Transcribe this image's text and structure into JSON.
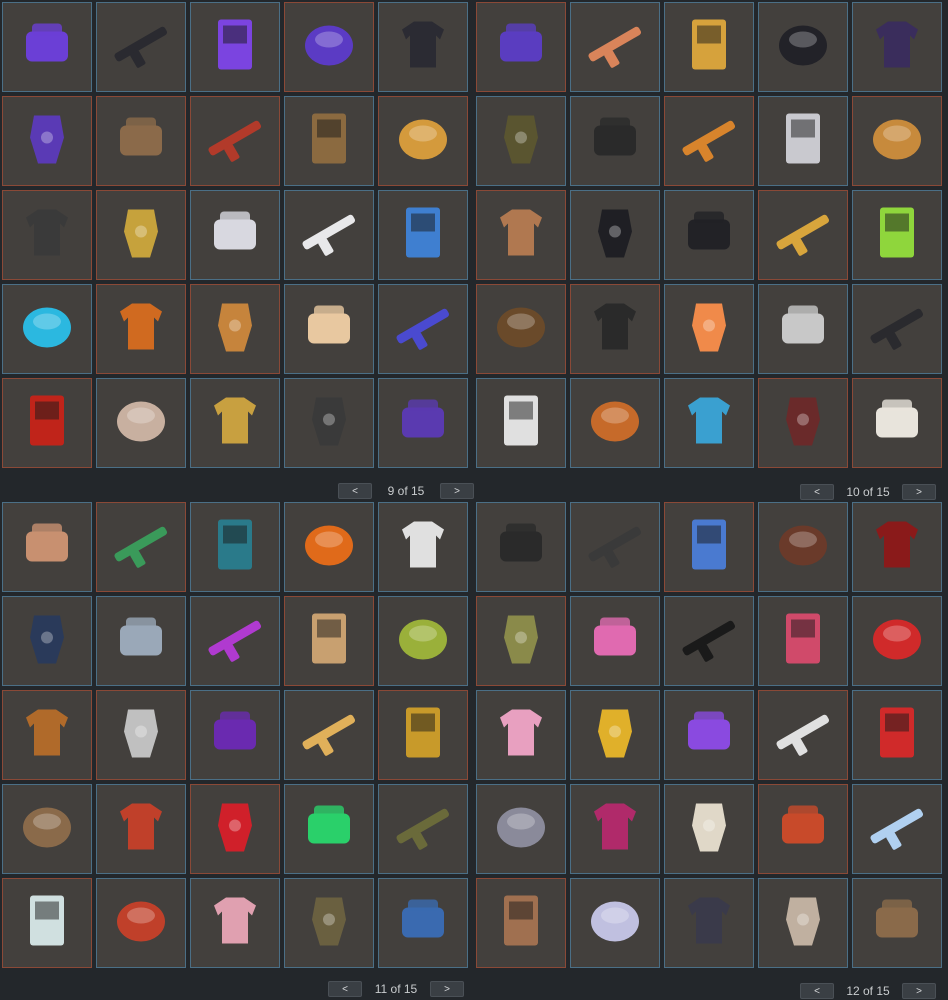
{
  "colors": {
    "background": "#23272b",
    "slot_fill": "#43403d",
    "border_blue": "#4b6f86",
    "border_red": "#8a4937"
  },
  "pagers": [
    {
      "prev_label": "<",
      "text": "9 of 15",
      "next_label": ">"
    },
    {
      "prev_label": "<",
      "text": "10 of 15",
      "next_label": ">"
    },
    {
      "prev_label": "<",
      "text": "11 of 15",
      "next_label": ">"
    },
    {
      "prev_label": "<",
      "text": "12 of 15",
      "next_label": ">"
    }
  ],
  "panels": [
    {
      "slots": [
        {
          "border": "b",
          "icon": "purple-helmet-icon",
          "color": "#6b3fd6"
        },
        {
          "border": "b",
          "icon": "backpack-icon",
          "color": "#2a2a30"
        },
        {
          "border": "b",
          "icon": "bandana-icon",
          "color": "#7b44e0"
        },
        {
          "border": "r",
          "icon": "pistol-icon",
          "color": "#5b3bc4"
        },
        {
          "border": "b",
          "icon": "vending-machine-icon",
          "color": "#2b2b33"
        },
        {
          "border": "r",
          "icon": "rifle-icon",
          "color": "#5a3dc0"
        },
        {
          "border": "b",
          "icon": "hoodie-icon",
          "color": "#d9845a"
        },
        {
          "border": "b",
          "icon": "vase-icon",
          "color": "#d6a23c"
        },
        {
          "border": "b",
          "icon": "crate-icon",
          "color": "#222228"
        },
        {
          "border": "b",
          "icon": "door-icon",
          "color": "#3a2d5c"
        },
        {
          "border": "r",
          "icon": "crossbow-icon",
          "color": "#5a3ab5"
        },
        {
          "border": "r",
          "icon": "hunting-rifle-icon",
          "color": "#8b6a4a"
        },
        {
          "border": "r",
          "icon": "banner-icon",
          "color": "#b23a2a"
        },
        {
          "border": "b",
          "icon": "sack-icon",
          "color": "#8b6a40"
        },
        {
          "border": "r",
          "icon": "waffle-hat-icon",
          "color": "#d49a3c"
        },
        {
          "border": "b",
          "icon": "pants-icon",
          "color": "#5a5530"
        },
        {
          "border": "b",
          "icon": "shotgun-icon",
          "color": "#2a2a2a"
        },
        {
          "border": "r",
          "icon": "scarf-icon",
          "color": "#d8842c"
        },
        {
          "border": "b",
          "icon": "cap-icon",
          "color": "#c9c9cf"
        },
        {
          "border": "r",
          "icon": "smg-icon",
          "color": "#c78a3c"
        },
        {
          "border": "r",
          "icon": "revolver-icon",
          "color": "#3a3a3a"
        },
        {
          "border": "r",
          "icon": "rocket-icon",
          "color": "#c6a23c"
        },
        {
          "border": "b",
          "icon": "armor-vest-icon",
          "color": "#d8d8e0"
        },
        {
          "border": "b",
          "icon": "mask-icon",
          "color": "#e8e8ea"
        },
        {
          "border": "b",
          "icon": "globe-helmet-icon",
          "color": "#3f7fd0"
        },
        {
          "border": "r",
          "icon": "assault-rifle-icon",
          "color": "#b07850"
        },
        {
          "border": "b",
          "icon": "jacket-icon",
          "color": "#1f1f24"
        },
        {
          "border": "b",
          "icon": "pants-dark-icon",
          "color": "#222226"
        },
        {
          "border": "r",
          "icon": "gloves-icon",
          "color": "#d8a53c"
        },
        {
          "border": "b",
          "icon": "hoodie-green-icon",
          "color": "#8fd63c"
        },
        {
          "border": "b",
          "icon": "tech-door-icon",
          "color": "#2bb8e0"
        },
        {
          "border": "r",
          "icon": "garage-door-icon",
          "color": "#d06a20"
        },
        {
          "border": "r",
          "icon": "rifle-floral-icon",
          "color": "#c6843c"
        },
        {
          "border": "b",
          "icon": "hammer-icon",
          "color": "#e8c8a0"
        },
        {
          "border": "b",
          "icon": "storage-box-icon",
          "color": "#4a4ad0"
        },
        {
          "border": "r",
          "icon": "pickaxe-icon",
          "color": "#6a4a2a"
        },
        {
          "border": "r",
          "icon": "sniper-icon",
          "color": "#2a2a2a"
        },
        {
          "border": "b",
          "icon": "sign-icon",
          "color": "#f08a4a"
        },
        {
          "border": "b",
          "icon": "lever-rifle-icon",
          "color": "#c8c8c8"
        },
        {
          "border": "b",
          "icon": "box-icon",
          "color": "#2a2a2e"
        },
        {
          "border": "r",
          "icon": "silhouette-banner-icon",
          "color": "#c0241a"
        },
        {
          "border": "b",
          "icon": "ter-door-icon",
          "color": "#c8b0a0"
        },
        {
          "border": "b",
          "icon": "sword-door-icon",
          "color": "#c8a040"
        },
        {
          "border": "b",
          "icon": "bat-icon",
          "color": "#3a3a3a"
        },
        {
          "border": "b",
          "icon": "purple-cap-icon",
          "color": "#5a3ab0"
        },
        {
          "border": "b",
          "icon": "white-rifle-icon",
          "color": "#e0e0e0"
        },
        {
          "border": "b",
          "icon": "furnace-icon",
          "color": "#c66a2a"
        },
        {
          "border": "b",
          "icon": "skull-mask-icon",
          "color": "#3aa0d0"
        },
        {
          "border": "r",
          "icon": "thompson-icon",
          "color": "#6a2a2a"
        },
        {
          "border": "r",
          "icon": "ak-white-icon",
          "color": "#e8e4dc"
        }
      ]
    },
    {
      "slots": [
        {
          "border": "b",
          "icon": "placeholder",
          "color": "#43403d"
        }
      ]
    },
    {
      "slots": [
        {
          "border": "b",
          "icon": "backpack-tan-icon",
          "color": "#c89070"
        },
        {
          "border": "r",
          "icon": "green-shotgun-icon",
          "color": "#3a9a5a"
        },
        {
          "border": "b",
          "icon": "vending-dark-icon",
          "color": "#2a7a8a"
        },
        {
          "border": "b",
          "icon": "lantern-locker-icon",
          "color": "#e06a1a"
        },
        {
          "border": "b",
          "icon": "rug-icon",
          "color": "#e0e0e0"
        },
        {
          "border": "b",
          "icon": "msrc-crate-icon",
          "color": "#2a3a5a"
        },
        {
          "border": "b",
          "icon": "tattered-shirt-icon",
          "color": "#9aa8b8"
        },
        {
          "border": "b",
          "icon": "neon-painting-icon",
          "color": "#b03ad0"
        },
        {
          "border": "r",
          "icon": "mallet-icon",
          "color": "#c8a070"
        },
        {
          "border": "b",
          "icon": "green-mask-icon",
          "color": "#9ab03a"
        },
        {
          "border": "r",
          "icon": "crossbow-gold-icon",
          "color": "#b06a2a"
        },
        {
          "border": "r",
          "icon": "machete-icon",
          "color": "#c0c0c0"
        },
        {
          "border": "b",
          "icon": "purple-furnace-icon",
          "color": "#6a2ab0"
        },
        {
          "border": "b",
          "icon": "candy-armor-icon",
          "color": "#e0b05a"
        },
        {
          "border": "r",
          "icon": "gold-smg-icon",
          "color": "#c89a2a"
        },
        {
          "border": "b",
          "icon": "wood-door-icon",
          "color": "#8a6a4a"
        },
        {
          "border": "b",
          "icon": "stained-door-icon",
          "color": "#c0402a"
        },
        {
          "border": "r",
          "icon": "neon-sign-icon",
          "color": "#d0202a"
        },
        {
          "border": "b",
          "icon": "green-vending-icon",
          "color": "#2ad06a"
        },
        {
          "border": "b",
          "icon": "camo-jacket-icon",
          "color": "#6a6a3a"
        },
        {
          "border": "r",
          "icon": "camo-ak-icon",
          "color": "#d0e0e0"
        },
        {
          "border": "b",
          "icon": "tribal-banner-icon",
          "color": "#c0402a"
        },
        {
          "border": "b",
          "icon": "pink-jacket-icon",
          "color": "#e0a0b0"
        },
        {
          "border": "b",
          "icon": "camo-pants-icon",
          "color": "#6a6040"
        },
        {
          "border": "b",
          "icon": "galaxy-door-icon",
          "color": "#3a6ab0"
        }
      ]
    },
    {
      "slots": [
        {
          "border": "b",
          "icon": "skull-bandana-icon",
          "color": "#2a2a2a"
        },
        {
          "border": "b",
          "icon": "skull-vest-icon",
          "color": "#3a3a3a"
        },
        {
          "border": "r",
          "icon": "blue-rifle-icon",
          "color": "#4a7ad0"
        },
        {
          "border": "b",
          "icon": "retro-door-icon",
          "color": "#6a3a2a"
        },
        {
          "border": "b",
          "icon": "red-shirt-icon",
          "color": "#8a1a1a"
        },
        {
          "border": "r",
          "icon": "camo-ak-tan-icon",
          "color": "#8a8a4a"
        },
        {
          "border": "b",
          "icon": "pink-pistol-icon",
          "color": "#e06ab0"
        },
        {
          "border": "b",
          "icon": "zebra-jacket-icon",
          "color": "#1a1a1a"
        },
        {
          "border": "b",
          "icon": "sunset-painting-icon",
          "color": "#d04a6a"
        },
        {
          "border": "b",
          "icon": "clown-mask-icon",
          "color": "#d02a2a"
        },
        {
          "border": "b",
          "icon": "candy-hammer-icon",
          "color": "#e8a0c0"
        },
        {
          "border": "b",
          "icon": "yellow-hoodie-icon",
          "color": "#e0b02a"
        },
        {
          "border": "b",
          "icon": "purple-boots-icon",
          "color": "#8a4ae0"
        },
        {
          "border": "r",
          "icon": "white-mp5-icon",
          "color": "#e0e0e0"
        },
        {
          "border": "b",
          "icon": "santa-suit-icon",
          "color": "#d02a2a"
        },
        {
          "border": "b",
          "icon": "grey-smg-icon",
          "color": "#8a8a9a"
        },
        {
          "border": "b",
          "icon": "pink-jacket-dark-icon",
          "color": "#b02a6a"
        },
        {
          "border": "b",
          "icon": "boonie-hat-icon",
          "color": "#e0d8c8"
        },
        {
          "border": "r",
          "icon": "flame-ak-icon",
          "color": "#c84a2a"
        },
        {
          "border": "b",
          "icon": "ice-crate-icon",
          "color": "#b0d0f0"
        },
        {
          "border": "r",
          "icon": "frosted-pistol-icon",
          "color": "#a07050"
        },
        {
          "border": "b",
          "icon": "holo-card-icon",
          "color": "#c0c0e0"
        },
        {
          "border": "b",
          "icon": "rainbow-door-icon",
          "color": "#3a3a4a"
        },
        {
          "border": "b",
          "icon": "stone-vase-icon",
          "color": "#c0b0a0"
        },
        {
          "border": "b",
          "icon": "wood-frame-icon",
          "color": "#8a6a4a"
        }
      ]
    }
  ]
}
